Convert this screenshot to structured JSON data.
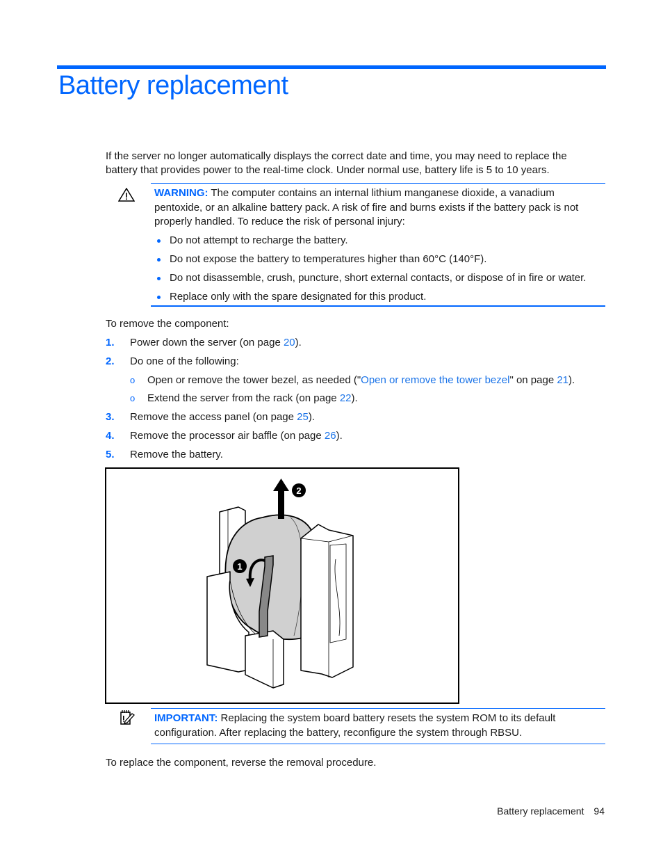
{
  "header": {
    "title": "Battery replacement"
  },
  "intro": {
    "line1": "If the server no longer automatically displays the correct date and time, you may need to replace the",
    "line2": "battery that provides power to the real-time clock. Under normal use, battery life is 5 to 10 years."
  },
  "warning": {
    "icon": "warning-triangle-icon",
    "label": "WARNING:",
    "line1": " The computer contains an internal lithium manganese dioxide, a vanadium",
    "line2": "pentoxide, or an alkaline battery pack. A risk of fire and burns exists if the battery pack is not",
    "line3": "properly handled. To reduce the risk of personal injury:",
    "bullets": [
      "Do not attempt to recharge the battery.",
      "Do not expose the battery to temperatures higher than 60°C (140°F).",
      "Do not disassemble, crush, puncture, short external contacts, or dispose of in fire or water.",
      "Replace only with the spare designated for this product."
    ]
  },
  "removal": {
    "intro": "To remove the component:",
    "steps": [
      {
        "num": "1.",
        "text": "Power down the server (on page ",
        "link": "20",
        "after": ")."
      },
      {
        "num": "2.",
        "text": "Do one of the following:"
      },
      {
        "num": "3.",
        "text": "Remove the access panel (on page ",
        "link": "25",
        "after": ")."
      },
      {
        "num": "4.",
        "text": "Remove the processor air baffle (on page ",
        "link": "26",
        "after": ")."
      },
      {
        "num": "5.",
        "text": "Remove the battery."
      }
    ],
    "substeps": [
      {
        "marker": "o",
        "text": "Open or remove the tower bezel, as needed (\"",
        "link": "Open or remove the tower bezel",
        "mid": "\" on page ",
        "link2": "21",
        "after": ")."
      },
      {
        "marker": "o",
        "text": "Extend the server from the rack (on page ",
        "link": "22",
        "after": ")."
      }
    ]
  },
  "figure": {
    "callouts": [
      "1",
      "2"
    ],
    "description": "Battery being removed from its holder"
  },
  "important": {
    "icon": "important-note-icon",
    "label": "IMPORTANT:",
    "line1": " Replacing the system board battery resets the system ROM to its default",
    "line2": "configuration. After replacing the battery, reconfigure the system through RBSU."
  },
  "outro": "To replace the component, reverse the removal procedure.",
  "footer": {
    "section": "Battery replacement",
    "page": "94"
  },
  "colors": {
    "accent": "#0066ff"
  }
}
